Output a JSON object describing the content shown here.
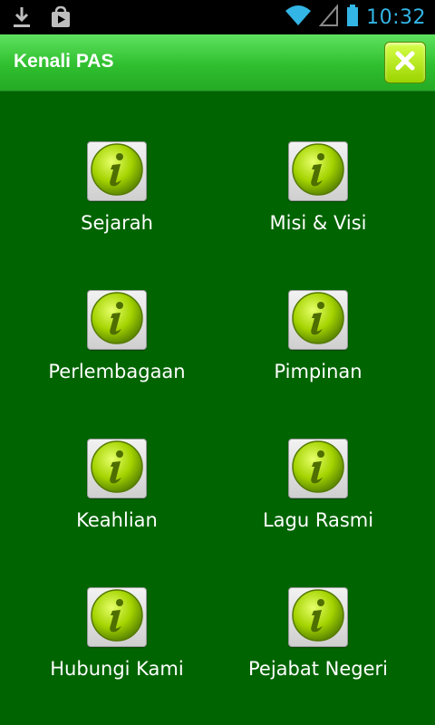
{
  "status_bar": {
    "time": "10:32",
    "icons": [
      "download-icon",
      "play-store-icon",
      "wifi-icon",
      "signal-icon",
      "battery-icon"
    ]
  },
  "app_bar": {
    "title": "Kenali PAS",
    "close_icon": "close-icon"
  },
  "menu": {
    "items": [
      {
        "label": "Sejarah",
        "icon": "info-icon"
      },
      {
        "label": "Misi & Visi",
        "icon": "info-icon"
      },
      {
        "label": "Perlembagaan",
        "icon": "info-icon"
      },
      {
        "label": "Pimpinan",
        "icon": "info-icon"
      },
      {
        "label": "Keahlian",
        "icon": "info-icon"
      },
      {
        "label": "Lagu Rasmi",
        "icon": "info-icon"
      },
      {
        "label": "Hubungi Kami",
        "icon": "info-icon"
      },
      {
        "label": "Pejabat Negeri",
        "icon": "info-icon"
      }
    ]
  },
  "colors": {
    "background": "#006400",
    "appbar": "#2fbf2f",
    "accent": "#33b5e5",
    "icon_green": "#a4d300"
  }
}
